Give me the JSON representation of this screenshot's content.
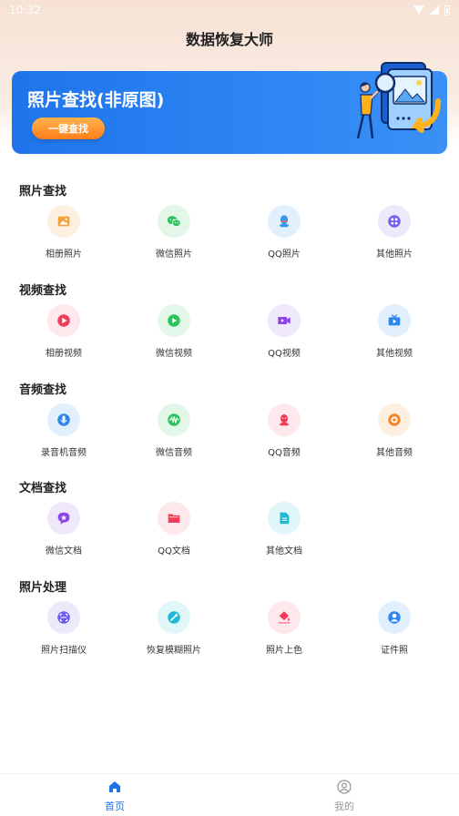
{
  "status_bar": {
    "time": "10:32"
  },
  "header": {
    "title": "数据恢复大师"
  },
  "banner": {
    "title": "照片查找(非原图)",
    "button_label": "一键查找"
  },
  "sections": [
    {
      "title": "照片查找",
      "items": [
        {
          "label": "相册照片",
          "icon": "album-photo-icon",
          "bg": "#fdf0e1",
          "color": "#f5a23c"
        },
        {
          "label": "微信照片",
          "icon": "wechat-icon",
          "bg": "#e3f7e8",
          "color": "#2cc25c"
        },
        {
          "label": "QQ照片",
          "icon": "qq-icon",
          "bg": "#e2f0fd",
          "color": "#3a97f0"
        },
        {
          "label": "其他照片",
          "icon": "other-photo-icon",
          "bg": "#ece9fb",
          "color": "#7a5bf0"
        }
      ]
    },
    {
      "title": "视频查找",
      "items": [
        {
          "label": "相册视频",
          "icon": "play-icon",
          "bg": "#fde9ec",
          "color": "#f23b58"
        },
        {
          "label": "微信视频",
          "icon": "wechat-video-icon",
          "bg": "#e3f7e8",
          "color": "#2cc25c"
        },
        {
          "label": "QQ视频",
          "icon": "video-camera-icon",
          "bg": "#efe8fb",
          "color": "#8c44e6"
        },
        {
          "label": "其他视频",
          "icon": "tv-icon",
          "bg": "#e2f0fd",
          "color": "#2f86ee"
        }
      ]
    },
    {
      "title": "音频查找",
      "items": [
        {
          "label": "录音机音频",
          "icon": "microphone-icon",
          "bg": "#e2f0fd",
          "color": "#2f86ee"
        },
        {
          "label": "微信音频",
          "icon": "waveform-icon",
          "bg": "#e3f7e8",
          "color": "#2cc25c"
        },
        {
          "label": "QQ音频",
          "icon": "qq-audio-icon",
          "bg": "#fde9ec",
          "color": "#f23b58"
        },
        {
          "label": "其他音频",
          "icon": "record-icon",
          "bg": "#fdf0e1",
          "color": "#f5862a"
        }
      ]
    },
    {
      "title": "文档查找",
      "items": [
        {
          "label": "微信文档",
          "icon": "chat-star-icon",
          "bg": "#efe8fb",
          "color": "#8c44e6"
        },
        {
          "label": "QQ文档",
          "icon": "folder-icon",
          "bg": "#fde9ec",
          "color": "#f23b58"
        },
        {
          "label": "其他文档",
          "icon": "document-icon",
          "bg": "#e0f6f8",
          "color": "#22b8d4"
        }
      ]
    },
    {
      "title": "照片处理",
      "items": [
        {
          "label": "照片扫描仪",
          "icon": "scanner-icon",
          "bg": "#ece9fb",
          "color": "#6a5cf0"
        },
        {
          "label": "恢复模糊照片",
          "icon": "magic-wand-icon",
          "bg": "#e0f6f8",
          "color": "#22b8d4"
        },
        {
          "label": "照片上色",
          "icon": "paint-bucket-icon",
          "bg": "#fde9ec",
          "color": "#f23b58"
        },
        {
          "label": "证件照",
          "icon": "id-photo-icon",
          "bg": "#e2f0fd",
          "color": "#2f86ee"
        }
      ]
    }
  ],
  "bottom_nav": {
    "tabs": [
      {
        "label": "首页",
        "icon": "home-icon",
        "active": true
      },
      {
        "label": "我的",
        "icon": "user-icon",
        "active": false
      }
    ],
    "active_color": "#1f74ea",
    "inactive_color": "#999999"
  }
}
